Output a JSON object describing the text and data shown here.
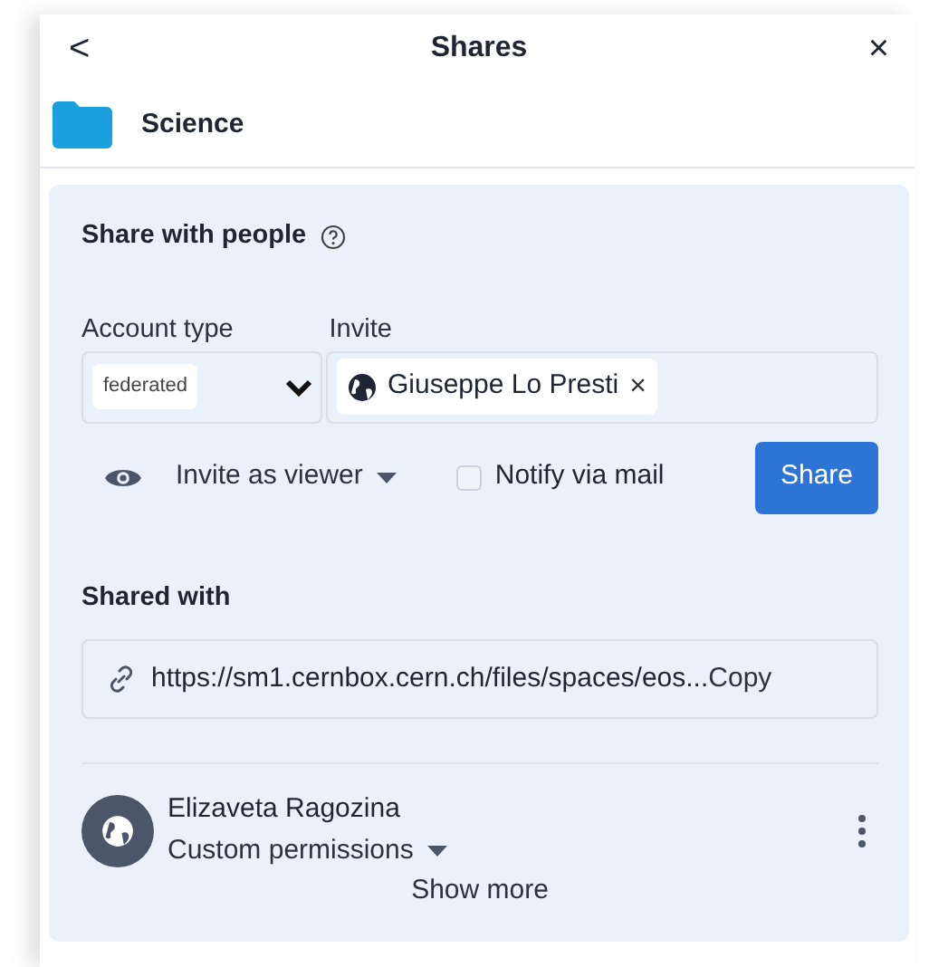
{
  "header": {
    "back": "<",
    "title": "Shares",
    "close": "×"
  },
  "resource": {
    "name": "Science"
  },
  "share_with_people": {
    "title": "Share with people",
    "account_type": {
      "label": "Account type",
      "value": "federated"
    },
    "invite": {
      "label": "Invite",
      "chips": [
        {
          "name": "Giuseppe Lo Presti",
          "remove": "×"
        }
      ]
    },
    "role": {
      "label": "Invite as viewer"
    },
    "notify": {
      "label": "Notify via mail",
      "checked": false
    },
    "share_button": "Share"
  },
  "shared_with": {
    "title": "Shared with",
    "link": {
      "url": "https://sm1.cernbox.cern.ch/files/spaces/eos...",
      "copy": "Copy"
    },
    "collaborators": [
      {
        "name": "Elizaveta Ragozina",
        "permissions": "Custom permissions"
      }
    ],
    "show_more": "Show more"
  }
}
